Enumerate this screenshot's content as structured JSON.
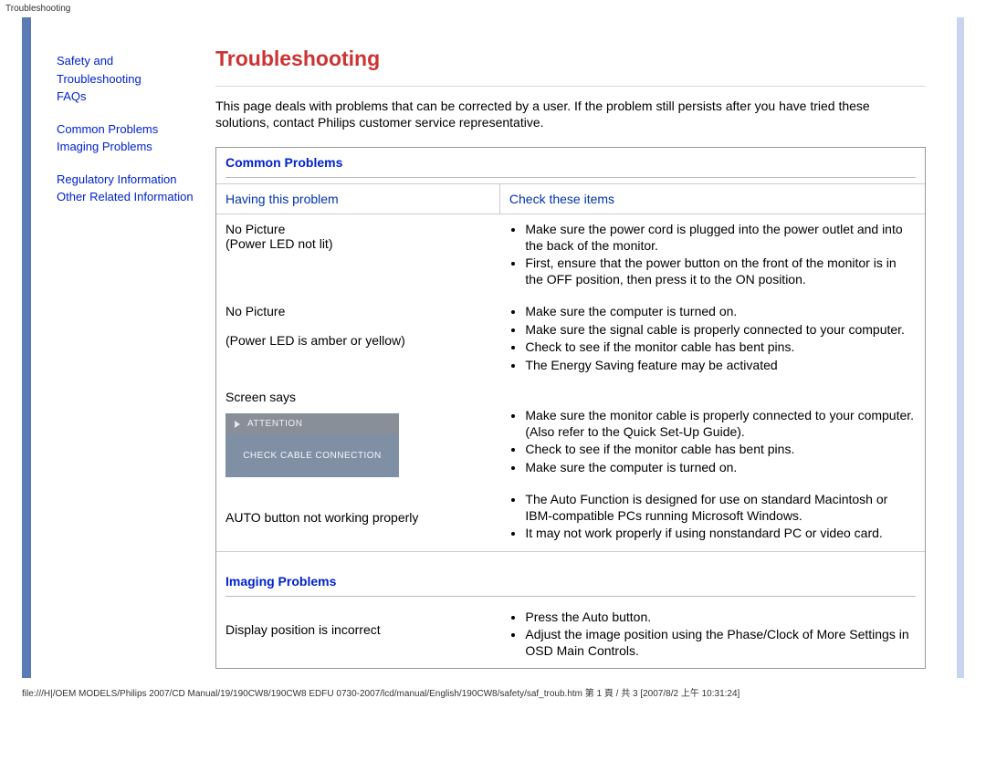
{
  "header": {
    "breadcrumb": "Troubleshooting"
  },
  "sidebar": {
    "group1": {
      "l1a": "Safety and",
      "l1b": "Troubleshooting",
      "l2": "FAQs"
    },
    "group2": {
      "l1": "Common Problems",
      "l2": "Imaging Problems"
    },
    "group3": {
      "l1": "Regulatory Information",
      "l2": "Other Related Information"
    }
  },
  "main": {
    "title": "Troubleshooting",
    "intro": "This page deals with problems that can be corrected by a user. If the problem still persists after you have tried these solutions, contact Philips customer service representative.",
    "section_common": "Common Problems",
    "col_problem": "Having this problem",
    "col_check": "Check these items",
    "rows": [
      {
        "problem_l1": "No Picture",
        "problem_l2": "(Power LED not lit)",
        "checks": [
          "Make sure the power cord is plugged into the power outlet and into the back of the monitor.",
          "First, ensure that the power button on the front of the monitor is in the OFF position, then press it to the ON position."
        ]
      },
      {
        "problem_l1": "No Picture",
        "problem_l2_blank": "",
        "problem_l3": "(Power LED is amber or yellow)",
        "checks": [
          "Make sure the computer is turned on.",
          "Make sure the signal cable is properly connected to your computer.",
          "Check to see if the monitor cable has bent pins.",
          "The Energy Saving feature may be activated"
        ]
      },
      {
        "problem_l1": "Screen says",
        "attention_head": "ATTENTION",
        "attention_body": "CHECK CABLE CONNECTION",
        "checks": [
          "Make sure the monitor cable is properly connected to your computer. (Also refer to the Quick Set-Up Guide).",
          "Check to see if the monitor cable has bent pins.",
          "Make sure the computer is turned on."
        ]
      },
      {
        "problem_l1": "AUTO button not working properly",
        "checks": [
          "The Auto Function is designed for use on standard Macintosh or IBM-compatible PCs running Microsoft Windows.",
          "It may not work properly if using nonstandard PC or video card."
        ]
      }
    ],
    "section_imaging": "Imaging Problems",
    "imaging_rows": [
      {
        "problem_l1": "Display position is incorrect",
        "checks": [
          "Press the Auto button.",
          "Adjust the image position using the Phase/Clock of More Settings in OSD Main Controls."
        ]
      }
    ]
  },
  "footer": {
    "text": "file:///H|/OEM MODELS/Philips 2007/CD Manual/19/190CW8/190CW8 EDFU 0730-2007/lcd/manual/English/190CW8/safety/saf_troub.htm 第 1 頁 / 共 3 [2007/8/2 上午 10:31:24]"
  }
}
